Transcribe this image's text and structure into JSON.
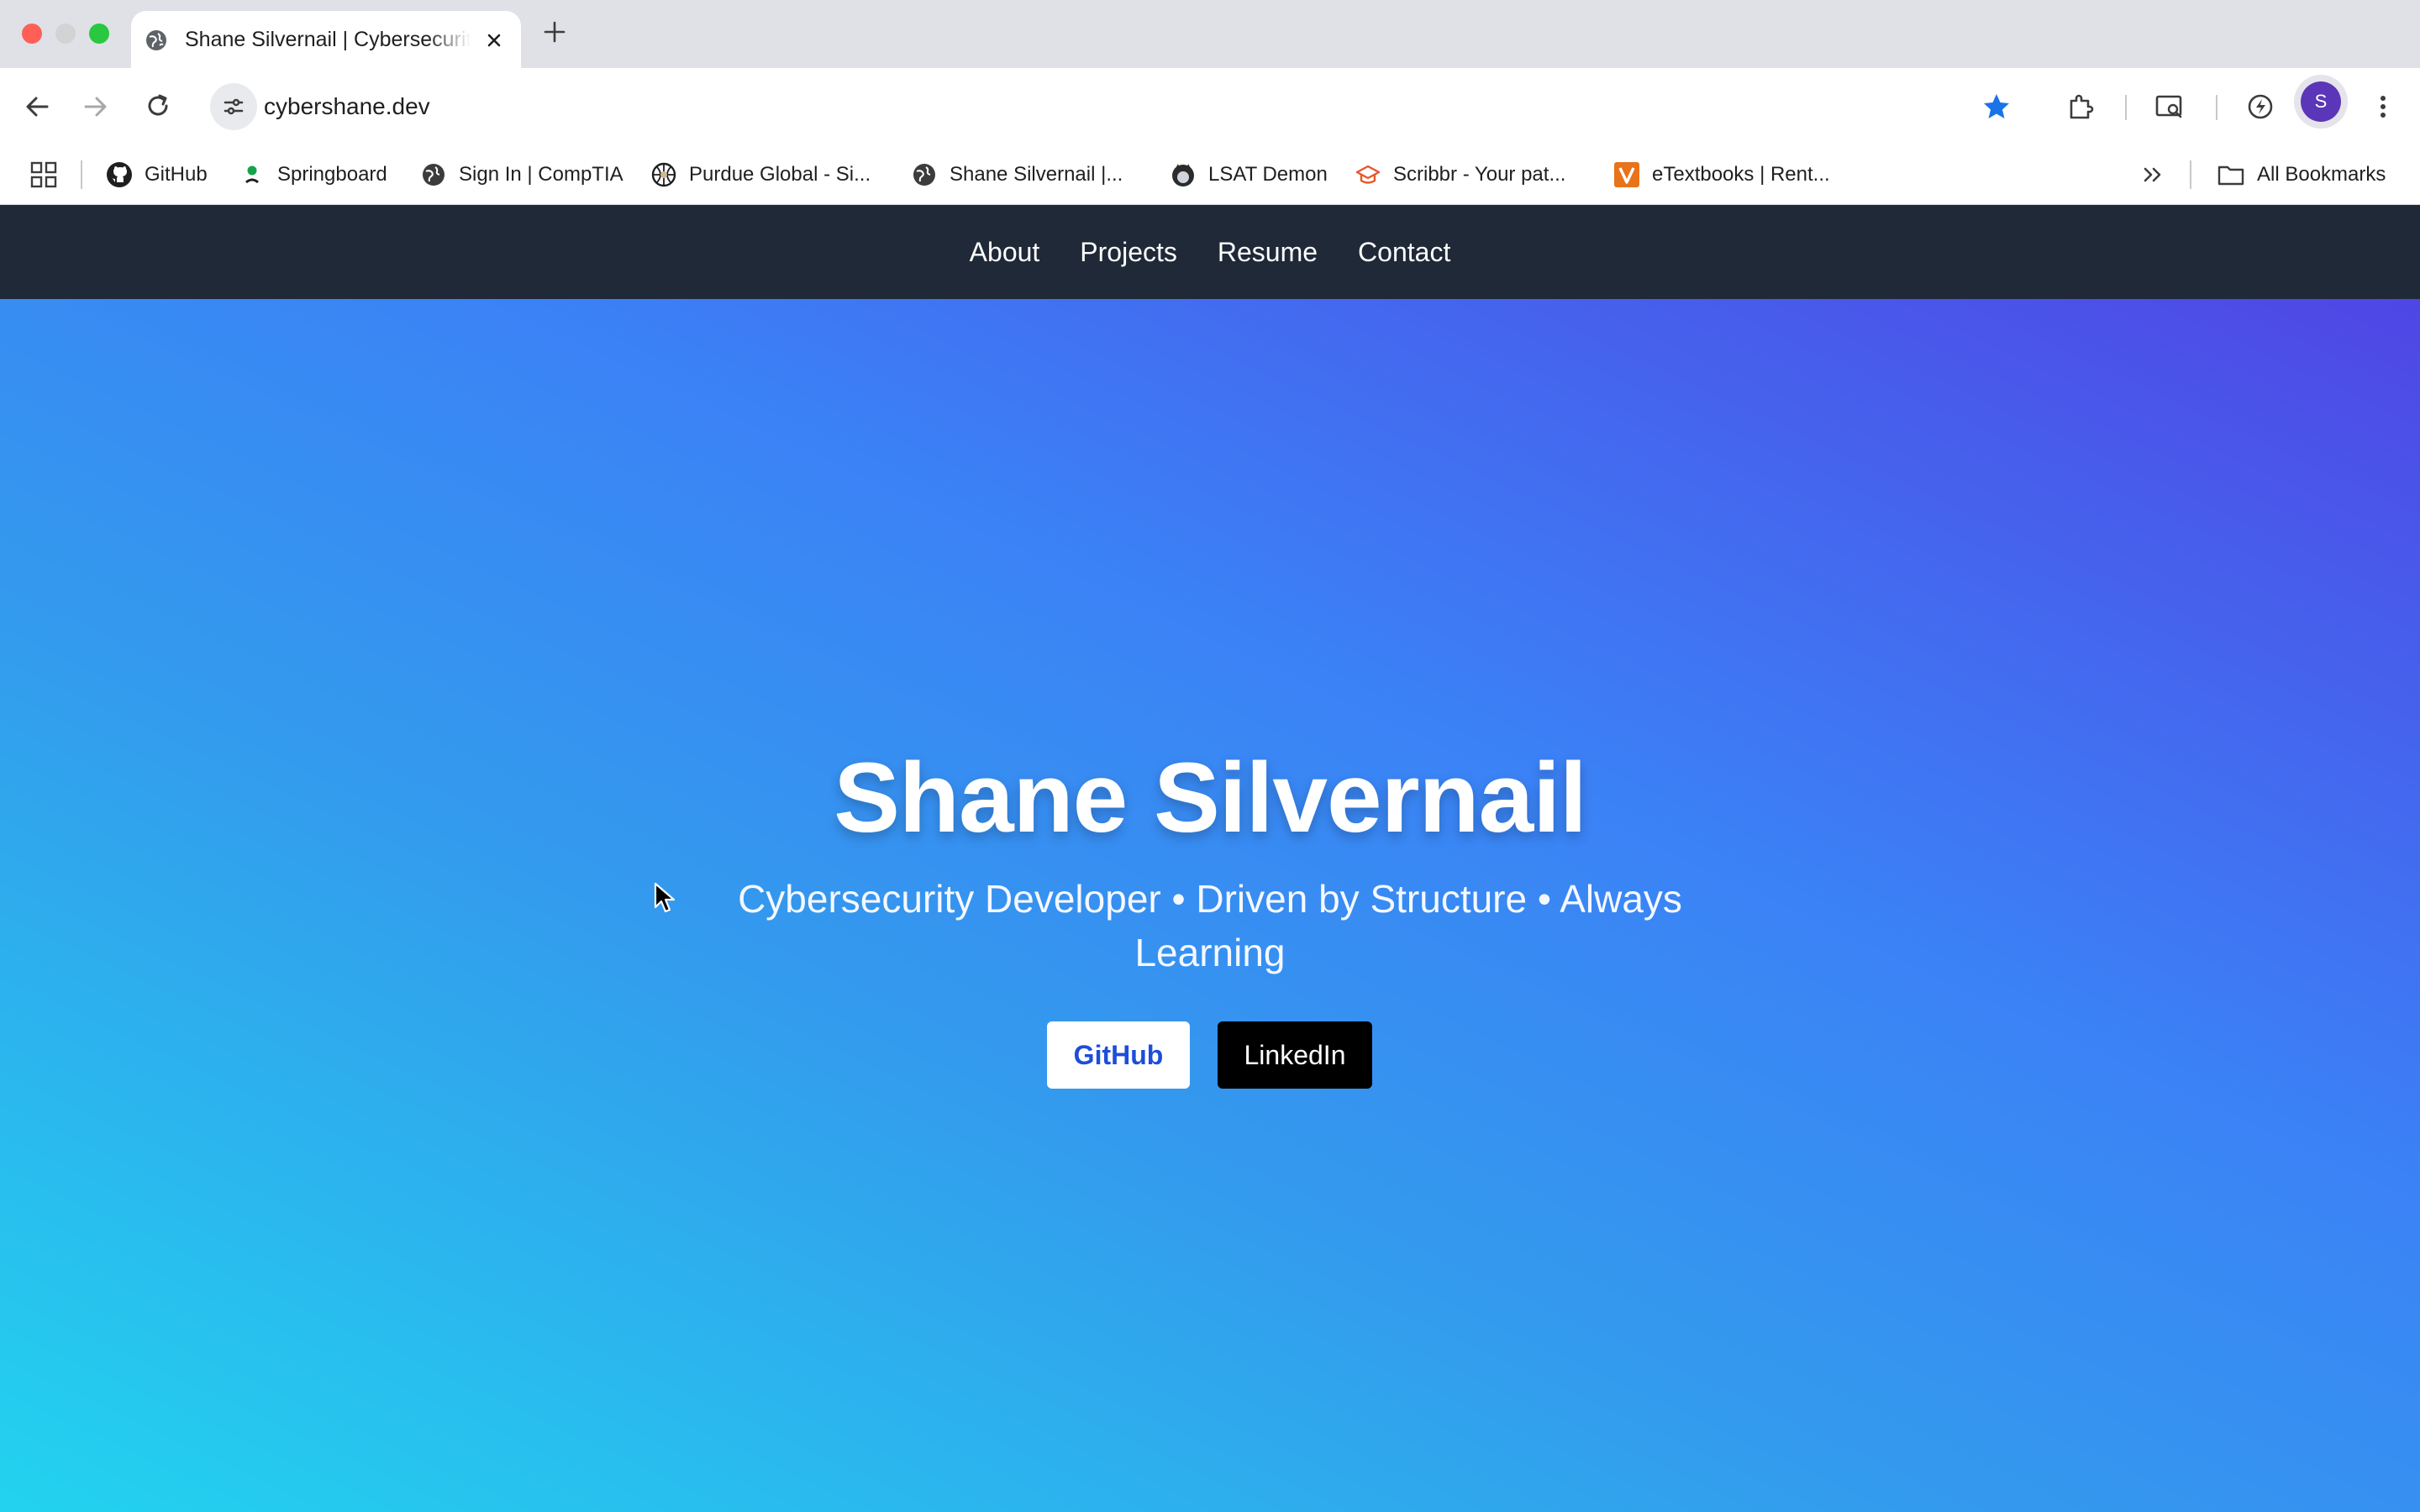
{
  "browser": {
    "tab": {
      "title": "Shane Silvernail | Cybersecurity Developer"
    },
    "url": "cybershane.dev",
    "profile_initial": "S",
    "bookmarks": [
      {
        "label": "GitHub",
        "icon": "github-icon"
      },
      {
        "label": "Springboard",
        "icon": "springboard-icon"
      },
      {
        "label": "Sign In | CompTIA",
        "icon": "globe-icon"
      },
      {
        "label": "Purdue Global - Si...",
        "icon": "purdue-icon"
      },
      {
        "label": "Shane Silvernail |...",
        "icon": "globe-icon"
      },
      {
        "label": "LSAT Demon",
        "icon": "lsat-demon-icon"
      },
      {
        "label": "Scribbr - Your pat...",
        "icon": "scribbr-icon"
      },
      {
        "label": "eTextbooks | Rent...",
        "icon": "vitalsource-icon"
      }
    ],
    "all_bookmarks_label": "All Bookmarks",
    "colors": {
      "star": "#1a73e8",
      "avatar": "#5b36b8"
    }
  },
  "site": {
    "nav": [
      "About",
      "Projects",
      "Resume",
      "Contact"
    ],
    "hero": {
      "title": "Shane Silvernail",
      "subtitle": "Cybersecurity Developer • Driven by Structure • Always Learning",
      "buttons": {
        "github": "GitHub",
        "linkedin": "LinkedIn"
      }
    },
    "colors": {
      "nav_bg": "#1f2937",
      "gradient_start": "#4f46e5",
      "gradient_end": "#22d3ee"
    }
  }
}
